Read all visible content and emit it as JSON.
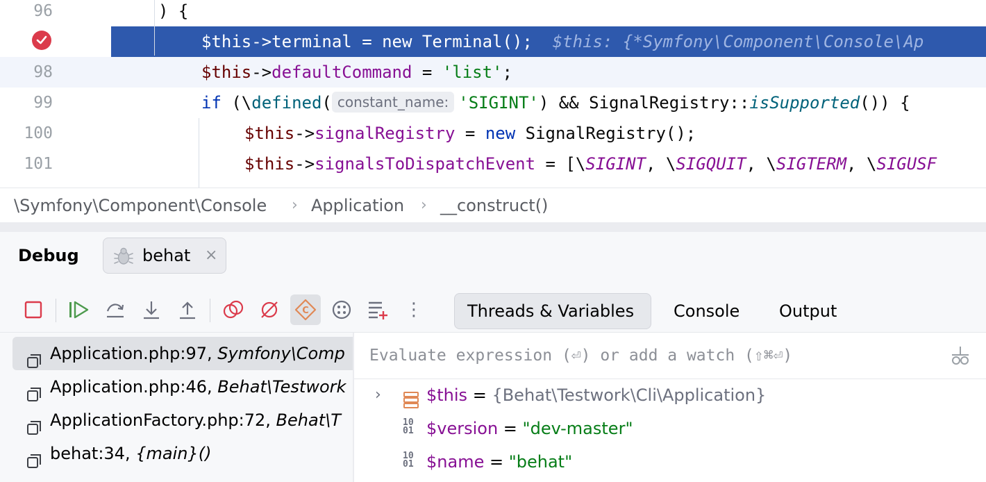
{
  "editor": {
    "lines": [
      {
        "num": "96",
        "code": ") {"
      },
      {
        "num": "",
        "code_a": "$this->terminal = new Terminal();",
        "inline_value": "$this: {*Symfony\\Component\\Console\\Ap"
      },
      {
        "num": "98",
        "var": "$this",
        "arrow": "->",
        "field": "defaultCommand",
        "eq": " = ",
        "str": "'list'",
        "end": ";"
      },
      {
        "num": "99",
        "kw": "if",
        "pre": " (\\",
        "fn": "defined",
        "paren": "(",
        "hint": "constant_name:",
        "str": "'SIGINT'",
        "rest": ") && SignalRegistry::",
        "fn2": "isSupported",
        "tail": "()) {"
      },
      {
        "num": "100",
        "var": "$this",
        "arrow": "->",
        "field": "signalRegistry",
        "eq": " = ",
        "kw": "new",
        "rest": " SignalRegistry();"
      },
      {
        "num": "101",
        "var": "$this",
        "arrow": "->",
        "field": "signalsToDispatchEvent",
        "rest": " = [\\",
        "c1": "SIGINT",
        "s1": ", \\",
        "c2": "SIGQUIT",
        "s2": ", \\",
        "c3": "SIGTERM",
        "s3": ", \\",
        "c4": "SIGUSF"
      }
    ]
  },
  "breadcrumb": {
    "items": [
      "\\Symfony\\Component\\Console",
      "Application",
      "__construct()"
    ],
    "separator": "›"
  },
  "debug": {
    "title": "Debug",
    "session_tab": "behat",
    "close": "×",
    "more": "⋮",
    "view_tabs": [
      "Threads & Variables",
      "Console",
      "Output"
    ],
    "frames": [
      {
        "loc": "Application.php:97, ",
        "ctx": "Symfony\\Comp"
      },
      {
        "loc": "Application.php:46, ",
        "ctx": "Behat\\Testwork"
      },
      {
        "loc": "ApplicationFactory.php:72, ",
        "ctx": "Behat\\T"
      },
      {
        "loc": "behat:34, ",
        "ctx": "{main}()"
      }
    ],
    "eval_placeholder": "Evaluate expression (⏎) or add a watch (⇧⌘⏎)",
    "variables": [
      {
        "name": "$this",
        "eq": " = ",
        "value": "{Behat\\Testwork\\Cli\\Application}",
        "expandable": "›"
      },
      {
        "name": "$version",
        "eq": " = ",
        "value": "\"dev-master\""
      },
      {
        "name": "$name",
        "eq": " = ",
        "value": "\"behat\""
      }
    ]
  },
  "colors": {
    "exec_line": "#2e59ad",
    "breakpoint": "#db3b4b",
    "string": "#067d17",
    "field": "#871094"
  }
}
